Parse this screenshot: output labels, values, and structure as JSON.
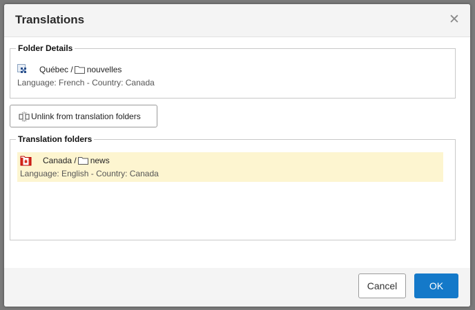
{
  "dialog": {
    "title": "Translations",
    "close_icon": "close-icon"
  },
  "folder_details": {
    "legend": "Folder Details",
    "region_icon": "region-grid-icon",
    "region_name": "Québec /",
    "folder_icon": "folder-icon",
    "folder_name": "nouvelles",
    "info": "Language: French - Country: Canada"
  },
  "unlink_button": {
    "icon": "unlink-icon",
    "label": "Unlink from translation folders"
  },
  "translation_folders": {
    "legend": "Translation folders",
    "items": [
      {
        "flag_icon": "canada-flag-icon",
        "region_name": "Canada /",
        "folder_icon": "folder-icon",
        "folder_name": "news",
        "info": "Language: English - Country: Canada",
        "highlight_color": "#fdf5d0"
      }
    ]
  },
  "footer": {
    "cancel_label": "Cancel",
    "ok_label": "OK",
    "ok_color": "#1479c9"
  }
}
